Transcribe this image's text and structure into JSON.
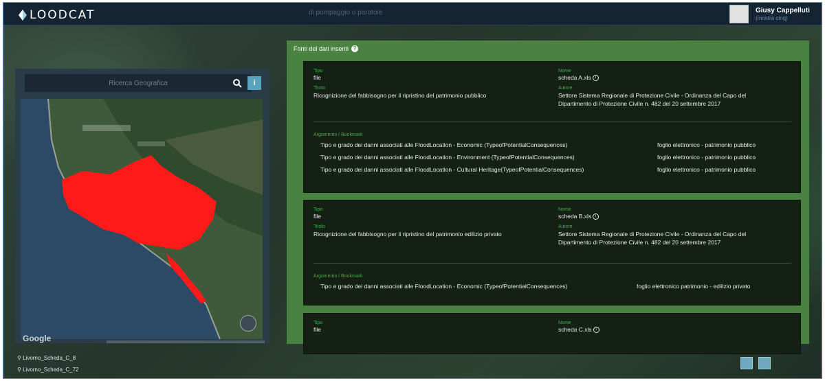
{
  "header": {
    "logo_text": "LOODCAT",
    "search_placeholder": "di pompaggio o paratoie",
    "user_name": "Giusy Cappelluti",
    "user_link": "(mostra cinq)"
  },
  "left_panel": {
    "search_placeholder": "Ricerca Geografica",
    "info_label": "i",
    "map_attribution": "Google"
  },
  "results": {
    "title": "Fonti dei dati inseriti",
    "cards": [
      {
        "tipo_label": "Tipo",
        "tipo": "file",
        "nome_label": "Nome",
        "nome": "scheda A.xls",
        "titolo_label": "Titolo",
        "titolo": "Ricognizione del fabbisogno per il ripristino del patrimonio pubblico",
        "autore_label": "Autore",
        "autore_1": "Settore Sistema Regionale di Protezione Civile - Ordinanza del Capo del",
        "autore_2": "Dipartimento di Protezione Civile n. 482 del 20 settembre 2017",
        "argomento_label": "Argomento / Bookmark",
        "rows": [
          {
            "desc": "Tipo e grado dei danni associati alle FloodLocation - Economic (TypeofPotentialConsequences)",
            "value": "foglio elettronico - patrimonio pubblico"
          },
          {
            "desc": "Tipo e grado dei danni associati alle FloodLocation - Environment (TypeofPotentialConsequences)",
            "value": "foglio elettronico - patrimonio pubblico"
          },
          {
            "desc": "Tipo e grado dei danni associati alle FloodLocation - Cultural Heritage(TypeofPotentialConsequences)",
            "value": "foglio elettronico - patrimonio pubblico"
          }
        ]
      },
      {
        "tipo_label": "Tipo",
        "tipo": "file",
        "nome_label": "Nome",
        "nome": "scheda B.xls",
        "titolo_label": "Titolo",
        "titolo": "Ricognizione del fabbisogno per il ripristino del patrimonio edilizio privato",
        "autore_label": "Autore",
        "autore_1": "Settore Sistema Regionale di Protezione Civile - Ordinanza del Capo del",
        "autore_2": "Dipartimento di Protezione Civile n. 482 del 20 settembre 2017",
        "argomento_label": "Argomento / Bookmark",
        "rows": [
          {
            "desc": "Tipo e grado dei danni associati alle FloodLocation - Economic (TypeofPotentialConsequences)",
            "value": "foglio elettronico patrimonio - edilizio privato"
          }
        ]
      },
      {
        "tipo_label": "Tipo",
        "tipo": "file",
        "nome_label": "Nome",
        "nome": "scheda C.xls"
      }
    ]
  },
  "bottom": {
    "locations": [
      "Livorno_Scheda_C_8",
      "Livorno_Scheda_C_72"
    ]
  },
  "colors": {
    "header_bg": "#142433",
    "results_bg": "#4a8242",
    "card_bg": "#132013",
    "label_green": "#3fb04a",
    "flood_red": "#ff1a1a",
    "info_button": "#5aa3bf"
  },
  "icons": {
    "search": "search-icon",
    "info": "info-icon",
    "help": "help-icon",
    "layers": "layers-icon",
    "edit": "edit-icon",
    "export": "export-icon",
    "location": "location-pin-icon"
  }
}
